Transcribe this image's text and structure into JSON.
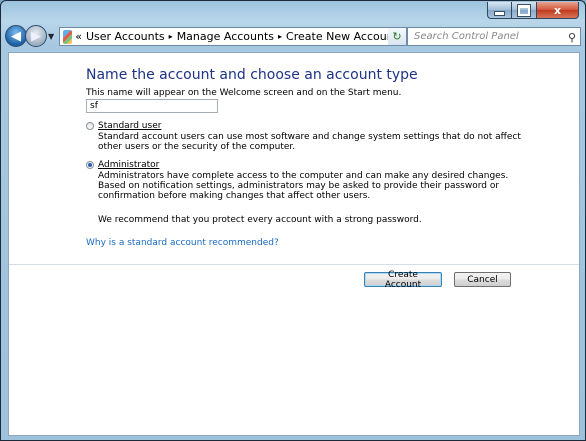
{
  "breadcrumb": {
    "prefix": "«",
    "items": [
      "User Accounts",
      "Manage Accounts",
      "Create New Account"
    ],
    "separator": "▸"
  },
  "search": {
    "placeholder": "Search Control Panel"
  },
  "page": {
    "title": "Name the account and choose an account type",
    "hint": "This name will appear on the Welcome screen and on the Start menu.",
    "account_name_value": "sf"
  },
  "options": {
    "standard": {
      "label": "Standard user",
      "selected": false,
      "description": "Standard account users can use most software and change system settings that do not affect other users or the security of the computer."
    },
    "administrator": {
      "label": "Administrator",
      "selected": true,
      "description": "Administrators have complete access to the computer and can make any desired changes. Based on notification settings, administrators may be asked to provide their password or confirmation before making changes that affect other users.",
      "recommendation": "We recommend that you protect every account with a strong password."
    }
  },
  "help_link": "Why is a standard account recommended?",
  "buttons": {
    "create": "Create Account",
    "cancel": "Cancel"
  },
  "caption_buttons": {
    "close_glyph": "x"
  },
  "colors": {
    "title_blue": "#1e3287",
    "link_blue": "#1a6bc4"
  }
}
